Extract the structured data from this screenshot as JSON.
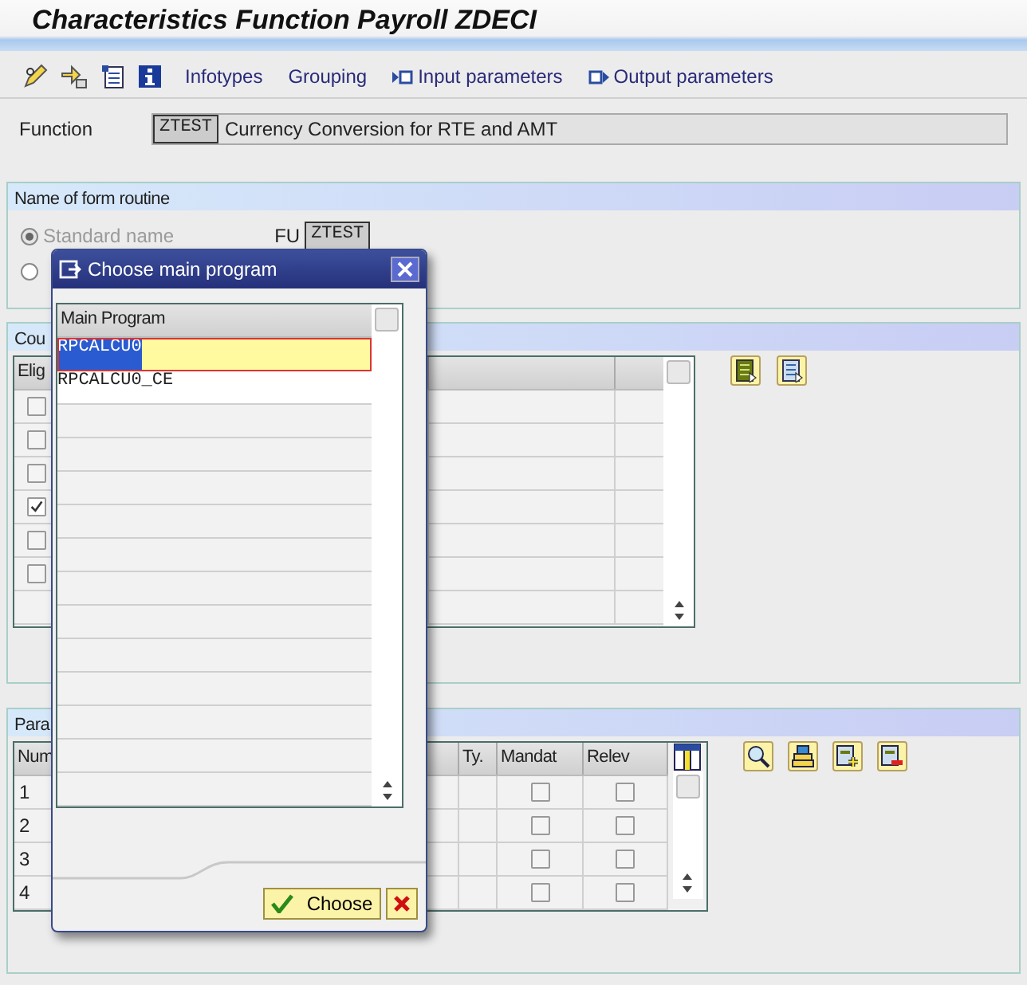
{
  "window": {
    "title": "Characteristics Function Payroll ZDECI"
  },
  "toolbar": [
    {
      "label": "Infotypes",
      "kind": "text"
    },
    {
      "label": "Grouping",
      "kind": "text"
    },
    {
      "label": "Input parameters",
      "kind": "input"
    },
    {
      "label": "Output parameters",
      "kind": "output"
    }
  ],
  "function": {
    "label": "Function",
    "code": "ZTEST",
    "description": "Currency Conversion for RTE and AMT"
  },
  "form_routine": {
    "title": "Name of form routine",
    "prefix": "FU",
    "name": "ZTEST",
    "options": [
      {
        "label": "Standard name",
        "selected": true,
        "disabled": true
      },
      {
        "selected": false
      }
    ]
  },
  "counter_section": {
    "title": "Cou",
    "column": "Elig",
    "rows": [
      {
        "checked": false
      },
      {
        "checked": false
      },
      {
        "checked": false
      },
      {
        "checked": true
      },
      {
        "checked": false
      },
      {
        "checked": false
      }
    ]
  },
  "parameter_section": {
    "title": "Para",
    "columns": [
      "Num",
      "Ty.",
      "Mandat",
      "Relev"
    ],
    "rows": [
      {
        "number": "1",
        "mandatory": false,
        "relevant": false
      },
      {
        "number": "2",
        "mandatory": false,
        "relevant": false
      },
      {
        "number": "3",
        "mandatory": false,
        "relevant": false
      },
      {
        "number": "4",
        "mandatory": false,
        "relevant": false
      }
    ]
  },
  "dialog": {
    "title": "Choose main program",
    "column": "Main Program",
    "rows": [
      {
        "name": "RPCALCU0",
        "selected": true
      },
      {
        "name": "RPCALCU0_CE",
        "selected": false
      }
    ],
    "buttons": [
      {
        "label": "Choose",
        "kind": "confirm"
      },
      {
        "kind": "cancel"
      }
    ]
  }
}
